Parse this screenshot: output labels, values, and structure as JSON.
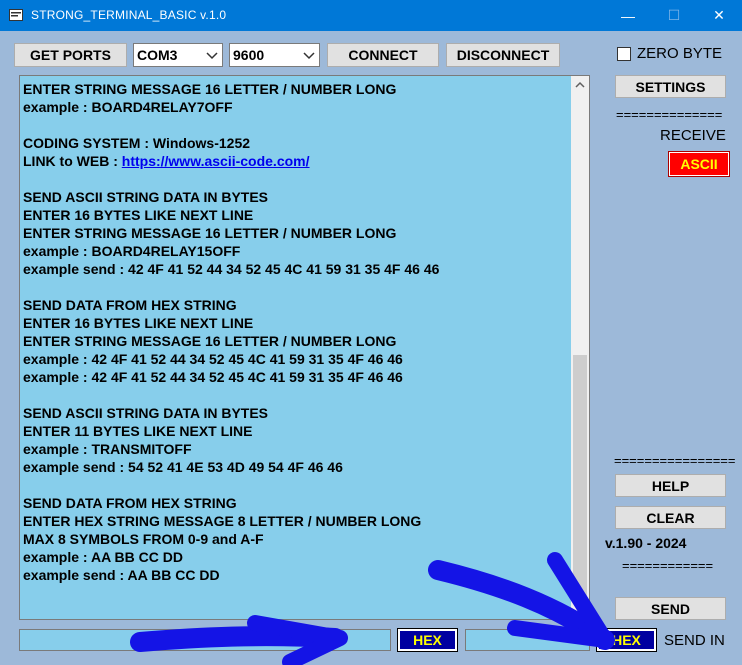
{
  "window": {
    "title": "STRONG_TERMINAL_BASIC v.1.0",
    "min_glyph": "—",
    "max_glyph": "☐",
    "close_glyph": "✕"
  },
  "toolbar": {
    "get_ports": "GET PORTS",
    "port_value": "COM3",
    "baud_value": "9600",
    "connect": "CONNECT",
    "disconnect": "DISCONNECT"
  },
  "right_panel": {
    "zero_byte": "ZERO BYTE",
    "zero_byte_checked": false,
    "settings": "SETTINGS",
    "separator_1": "==============",
    "receive_label": "RECEIVE",
    "receive_mode": "ASCII",
    "separator_2": "================",
    "help": "HELP",
    "clear": "CLEAR",
    "version": "v.1.90 - 2024",
    "separator_3": "============",
    "send": "SEND",
    "send_in_label": "SEND IN"
  },
  "bottom": {
    "input_1_value": "",
    "hex_1": "HEX",
    "input_2_value": "",
    "hex_2": "HEX"
  },
  "terminal_lines": [
    {
      "text": "ENTER STRING MESSAGE 16 LETTER / NUMBER LONG"
    },
    {
      "text": "example : BOARD4RELAY7OFF"
    },
    {
      "text": ""
    },
    {
      "text": "CODING SYSTEM : Windows-1252"
    },
    {
      "text": "LINK to WEB : ",
      "link": "https://www.ascii-code.com/"
    },
    {
      "text": ""
    },
    {
      "text": "SEND ASCII STRING DATA IN BYTES"
    },
    {
      "text": "ENTER 16 BYTES LIKE NEXT LINE"
    },
    {
      "text": "ENTER STRING MESSAGE 16 LETTER / NUMBER LONG"
    },
    {
      "text": "example : BOARD4RELAY15OFF"
    },
    {
      "text": "example send : 42 4F 41 52 44 34 52 45 4C 41 59 31 35 4F 46 46"
    },
    {
      "text": ""
    },
    {
      "text": "SEND DATA FROM HEX STRING"
    },
    {
      "text": "ENTER 16 BYTES LIKE NEXT LINE"
    },
    {
      "text": "ENTER STRING MESSAGE 16 LETTER / NUMBER LONG"
    },
    {
      "text": "example : 42 4F 41 52 44 34 52 45 4C 41 59 31 35 4F 46 46"
    },
    {
      "text": "example : 42 4F 41 52 44 34 52 45 4C 41 59 31 35 4F 46 46"
    },
    {
      "text": ""
    },
    {
      "text": "SEND ASCII STRING DATA IN BYTES"
    },
    {
      "text": "ENTER 11 BYTES LIKE NEXT LINE"
    },
    {
      "text": "example : TRANSMITOFF"
    },
    {
      "text": "example send : 54 52 41 4E 53 4D 49 54 4F 46 46"
    },
    {
      "text": ""
    },
    {
      "text": "SEND DATA FROM HEX STRING"
    },
    {
      "text": "ENTER HEX STRING MESSAGE 8 LETTER / NUMBER LONG"
    },
    {
      "text": "MAX 8 SYMBOLS FROM 0-9 and A-F"
    },
    {
      "text": "example : AA BB CC DD"
    },
    {
      "text": "example send : AA BB CC DD"
    }
  ],
  "colors": {
    "client_bg": "#9db9d9",
    "terminal_bg": "#87ceeb",
    "titlebar": "#0078d7",
    "ascii_bg": "#ff0000",
    "ascii_text": "#ffff00",
    "hex_bg": "#0000a0",
    "annotation_arrow": "#1414e6"
  }
}
